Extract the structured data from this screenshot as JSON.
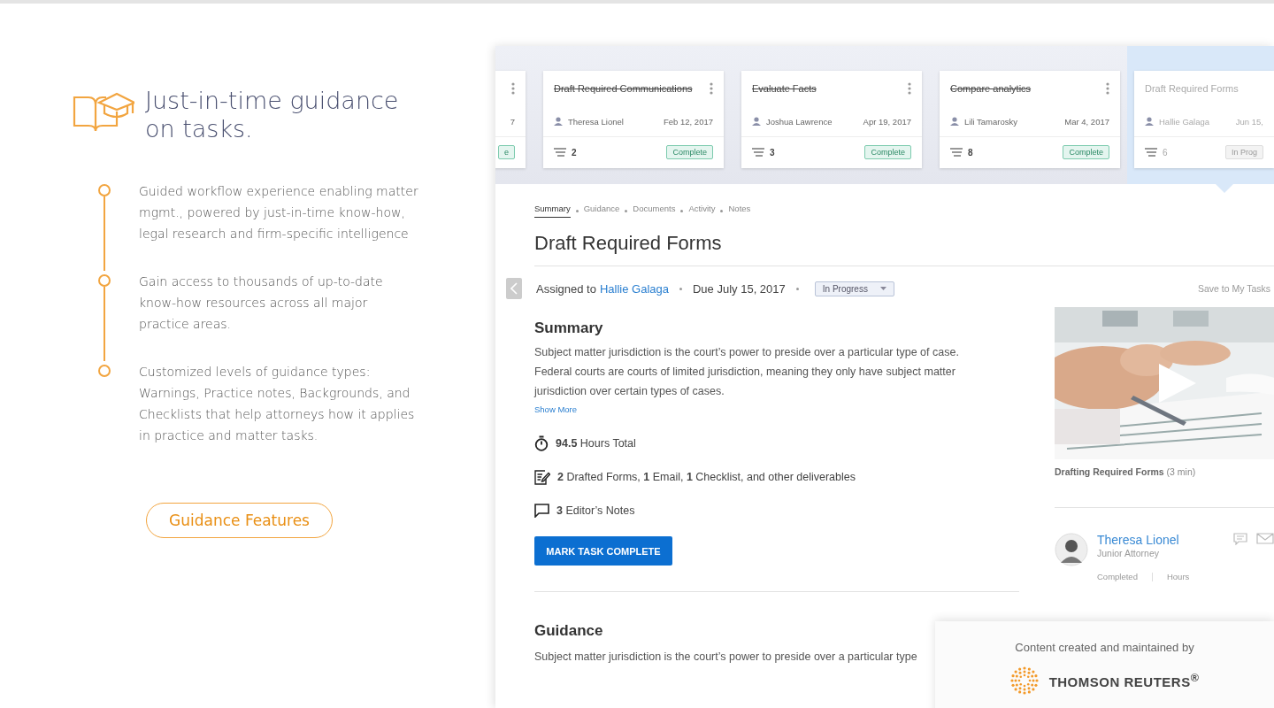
{
  "intro": {
    "title": "Just-in-time guidance on tasks.",
    "points": [
      "Guided workflow experience enabling matter mgmt., powered by just-in-time know-how, legal research and firm-specific intelligence",
      "Gain access to thousands of up-to-date know-how resources across all major practice areas.",
      "Customized levels of guidance types: Warnings, Practice notes, Backgrounds, and Checklists that help attorneys how it applies in practice and matter tasks."
    ],
    "button": "Guidance Features"
  },
  "task_cards": [
    {
      "date": "7",
      "status": "e",
      "completed": true,
      "selected": false
    },
    {
      "title": "Draft Required Communications",
      "assignee": "Theresa Lionel",
      "date": "Feb 12, 2017",
      "count": "2",
      "status": "Complete",
      "completed": true,
      "selected": false
    },
    {
      "title": "Evaluate Facts",
      "assignee": "Joshua Lawrence",
      "date": "Apr 19, 2017",
      "count": "3",
      "status": "Complete",
      "completed": true,
      "selected": false
    },
    {
      "title": "Compare analytics",
      "assignee": "Lili Tamarosky",
      "date": "Mar 4, 2017",
      "count": "8",
      "status": "Complete",
      "completed": true,
      "selected": false
    },
    {
      "title": "Draft Required Forms",
      "assignee": "Hallie Galaga",
      "date": "Jun 15,",
      "count": "6",
      "status": "In Prog",
      "completed": false,
      "selected": true
    }
  ],
  "tabs": [
    {
      "label": "Summary",
      "selected": true
    },
    {
      "label": "Guidance",
      "selected": false
    },
    {
      "label": "Documents",
      "selected": false
    },
    {
      "label": "Activity",
      "selected": false
    },
    {
      "label": "Notes",
      "selected": false
    }
  ],
  "task": {
    "title": "Draft Required Forms",
    "assigned_label": "Assigned to",
    "assignee": "Hallie Galaga",
    "due": "Due July 15, 2017",
    "status": "In Progress",
    "save": "Save to My Tasks"
  },
  "summary": {
    "heading": "Summary",
    "text": "Subject matter jurisdiction is the court’s power to preside over a particular type of case. Federal courts are courts of limited jurisdiction, meaning they only have subject matter jurisdiction over certain types of cases.",
    "more": "Show More",
    "stats": [
      {
        "kind": "timer",
        "text": "**94.5** Hours Total"
      },
      {
        "kind": "form",
        "text": "**2** Drafted Forms, **1** Email,  **1** Checklist, and other deliverables"
      },
      {
        "kind": "notes",
        "text": "**3** Editor’s Notes"
      }
    ],
    "button": "MARK TASK COMPLETE"
  },
  "video": {
    "caption": "**Drafting Required Forms** (3 min)"
  },
  "person": {
    "name": "Theresa Lionel",
    "role": "Junior Attorney",
    "labels": [
      "Completed",
      "Hours"
    ]
  },
  "guidance": {
    "heading": "Guidance",
    "text": "Subject matter jurisdiction is the court’s power to preside over a particular type"
  },
  "credit": {
    "text": "Content created and maintained  by",
    "brand": "THOMSON REUTERS$^{®}$"
  }
}
